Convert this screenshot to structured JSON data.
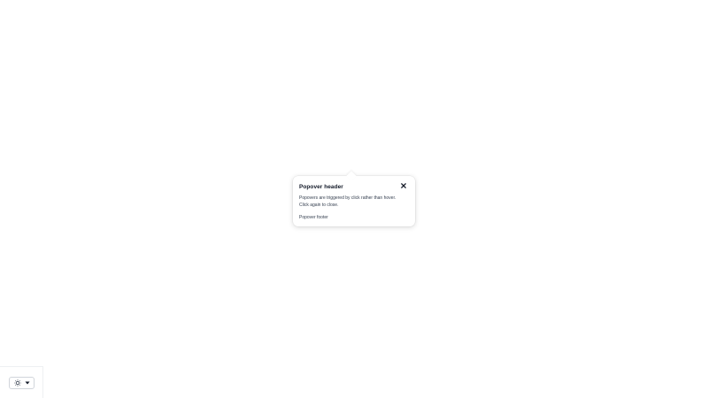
{
  "popover": {
    "title": "Popover header",
    "body": "Popovers are triggered by click rather than hover. Click again to close.",
    "footer": "Popover footer",
    "close_icon": "close-icon"
  },
  "theme_toggle": {
    "icon": "sun-icon",
    "dropdown_icon": "caret-down-icon"
  }
}
